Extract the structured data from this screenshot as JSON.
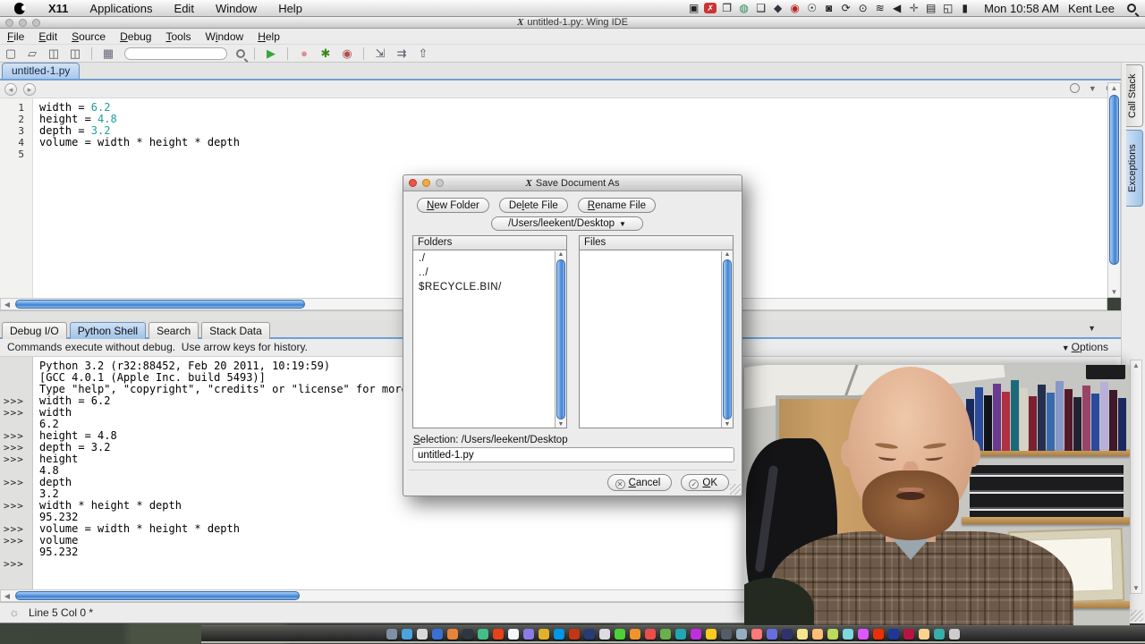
{
  "menubar": {
    "items": [
      "X11",
      "Applications",
      "Edit",
      "Window",
      "Help"
    ],
    "status_icons": [
      {
        "name": "camera-icon",
        "glyph": "▣",
        "color": "#222"
      },
      {
        "name": "x11-badge-icon",
        "glyph": "✗",
        "color": "#fff",
        "bg": "#cc3333"
      },
      {
        "name": "windows-icon",
        "glyph": "❐",
        "color": "#222"
      },
      {
        "name": "network-globe-icon",
        "glyph": "◍",
        "color": "#2e8b57"
      },
      {
        "name": "chat-bubble-icon",
        "glyph": "❑",
        "color": "#222"
      },
      {
        "name": "shield-icon",
        "glyph": "◆",
        "color": "#333344"
      },
      {
        "name": "record-icon",
        "glyph": "◉",
        "color": "#bb2222"
      },
      {
        "name": "accessibility-icon",
        "glyph": "☉",
        "color": "#222"
      },
      {
        "name": "lock-icon",
        "glyph": "◙",
        "color": "#222"
      },
      {
        "name": "sync-icon",
        "glyph": "⟳",
        "color": "#222"
      },
      {
        "name": "alert-clock-icon",
        "glyph": "⊙",
        "color": "#222"
      },
      {
        "name": "wifi-icon",
        "glyph": "≋",
        "color": "#222"
      },
      {
        "name": "volume-icon",
        "glyph": "◀",
        "color": "#222"
      },
      {
        "name": "spaces-icon",
        "glyph": "✛",
        "color": "#555"
      },
      {
        "name": "display-icon",
        "glyph": "▤",
        "color": "#222"
      },
      {
        "name": "window-switch-icon",
        "glyph": "◱",
        "color": "#222"
      },
      {
        "name": "battery-icon",
        "glyph": "▮",
        "color": "#222"
      }
    ],
    "clock": "Mon 10:58 AM",
    "user": "Kent Lee"
  },
  "window": {
    "title": "untitled-1.py: Wing IDE",
    "menu": [
      {
        "label": "File",
        "m": 0
      },
      {
        "label": "Edit",
        "m": 0
      },
      {
        "label": "Source",
        "m": 0
      },
      {
        "label": "Debug",
        "m": 0
      },
      {
        "label": "Tools",
        "m": 0
      },
      {
        "label": "Window",
        "m": 1
      },
      {
        "label": "Help",
        "m": 0
      }
    ],
    "toolbar_group1": [
      {
        "name": "new-file-icon",
        "glyph": "▢",
        "color": "#555"
      },
      {
        "name": "open-file-icon",
        "glyph": "▱",
        "color": "#555"
      },
      {
        "name": "save-icon",
        "glyph": "◫",
        "color": "#555"
      },
      {
        "name": "save-all-icon",
        "glyph": "◫",
        "color": "#555"
      },
      {
        "sep": true
      },
      {
        "name": "fragment-icon",
        "glyph": "▦",
        "color": "#667"
      }
    ],
    "toolbar_group2": [
      {
        "sep": true
      },
      {
        "name": "run-icon",
        "glyph": "▶",
        "color": "#3aa63a"
      },
      {
        "sep": true
      },
      {
        "name": "pause-icon",
        "glyph": "●",
        "color": "#d89090"
      },
      {
        "name": "debug-bug-icon",
        "glyph": "✱",
        "color": "#3a8a1a"
      },
      {
        "name": "stop-icon",
        "glyph": "◉",
        "color": "#b05050"
      },
      {
        "sep": true
      },
      {
        "name": "step-into-icon",
        "glyph": "⇲",
        "color": "#556"
      },
      {
        "name": "step-over-icon",
        "glyph": "⇉",
        "color": "#556"
      },
      {
        "name": "step-out-icon",
        "glyph": "⇧",
        "color": "#556"
      }
    ],
    "editor_tab": "untitled-1.py",
    "code_lines": [
      {
        "num": "1",
        "segs": [
          {
            "t": "width = ",
            "c": "p"
          },
          {
            "t": "6.2",
            "c": "n"
          }
        ]
      },
      {
        "num": "2",
        "segs": [
          {
            "t": "height = ",
            "c": "p"
          },
          {
            "t": "4.8",
            "c": "n"
          }
        ]
      },
      {
        "num": "3",
        "segs": [
          {
            "t": "depth = ",
            "c": "p"
          },
          {
            "t": "3.2",
            "c": "n"
          }
        ]
      },
      {
        "num": "4",
        "segs": [
          {
            "t": "volume = width * height * depth",
            "c": "p"
          }
        ]
      },
      {
        "num": "5",
        "segs": []
      }
    ],
    "bottom_tabs": [
      {
        "label": "Debug I/O",
        "active": false
      },
      {
        "label": "Python Shell",
        "active": true
      },
      {
        "label": "Search",
        "active": false
      },
      {
        "label": "Stack Data",
        "active": false
      }
    ],
    "info_message": "Commands execute without debug.  Use arrow keys for history.",
    "options": {
      "label": "Options",
      "m": 0
    },
    "shell_lines": [
      {
        "prompt": false,
        "text": "Python 3.2 (r32:88452, Feb 20 2011, 10:19:59)"
      },
      {
        "prompt": false,
        "text": "[GCC 4.0.1 (Apple Inc. build 5493)]"
      },
      {
        "prompt": false,
        "text": "Type \"help\", \"copyright\", \"credits\" or \"license\" for more information."
      },
      {
        "prompt": true,
        "text": "width = 6.2"
      },
      {
        "prompt": true,
        "text": "width"
      },
      {
        "prompt": false,
        "text": "6.2"
      },
      {
        "prompt": true,
        "text": "height = 4.8"
      },
      {
        "prompt": true,
        "text": "depth = 3.2"
      },
      {
        "prompt": true,
        "text": "height"
      },
      {
        "prompt": false,
        "text": "4.8"
      },
      {
        "prompt": true,
        "text": "depth"
      },
      {
        "prompt": false,
        "text": "3.2"
      },
      {
        "prompt": true,
        "text": "width * height * depth"
      },
      {
        "prompt": false,
        "text": "95.232"
      },
      {
        "prompt": true,
        "text": "volume = width * height * depth"
      },
      {
        "prompt": true,
        "text": "volume"
      },
      {
        "prompt": false,
        "text": "95.232"
      },
      {
        "prompt": true,
        "text": ""
      }
    ],
    "prompt_glyph": ">>>",
    "status_text": "Line 5 Col 0 *",
    "side_tabs": [
      {
        "label": "Call Stack",
        "active": false
      },
      {
        "label": "Exceptions",
        "active": true
      }
    ]
  },
  "dialog": {
    "title": "Save Document As",
    "buttons": [
      {
        "label": "New Folder",
        "m": 0
      },
      {
        "label": "Delete File",
        "m": 2
      },
      {
        "label": "Rename File",
        "m": 0
      }
    ],
    "path": "/Users/leekent/Desktop",
    "folders_header": "Folders",
    "files_header": "Files",
    "folders": [
      "./",
      "../",
      "$RECYCLE.BIN/"
    ],
    "files": [],
    "selection": {
      "label": "Selection: /Users/leekent/Desktop",
      "m": 0
    },
    "filename": "untitled-1.py",
    "cancel": {
      "label": "Cancel",
      "m": 0
    },
    "ok": {
      "label": "OK",
      "m": 0
    }
  },
  "colors": {
    "accent_blue": "#6ea0d8",
    "tab_active": "#aac9ea",
    "code_number": "#1f9e9e",
    "scroll_thumb": "#5d9ae0",
    "dialog_light_close": "#ee5548",
    "dialog_light_minimize": "#f5a93c",
    "dialog_light_zoom_disabled": "#c8c8c8"
  },
  "dock": {
    "icon_colors": [
      "#7f8fa6",
      "#4aa3df",
      "#d9d9d9",
      "#3b6fd4",
      "#e8833a",
      "#2f3640",
      "#44bd87",
      "#e84118",
      "#f5f6fa",
      "#8c7ae6",
      "#e1b12c",
      "#0097e6",
      "#c23616",
      "#273c75",
      "#dcdde1",
      "#4cd137",
      "#f0932b",
      "#eb4d4b",
      "#6ab04c",
      "#22a6b3",
      "#be2edd",
      "#f9ca24",
      "#535c68",
      "#95afc0",
      "#ff7979",
      "#686de0",
      "#30336b",
      "#f6e58d",
      "#ffbe76",
      "#badc58",
      "#7ed6df",
      "#e056fd",
      "#eb2f06",
      "#1e3799",
      "#b71540",
      "#fad390",
      "#38ada9",
      "#cccccc"
    ]
  }
}
